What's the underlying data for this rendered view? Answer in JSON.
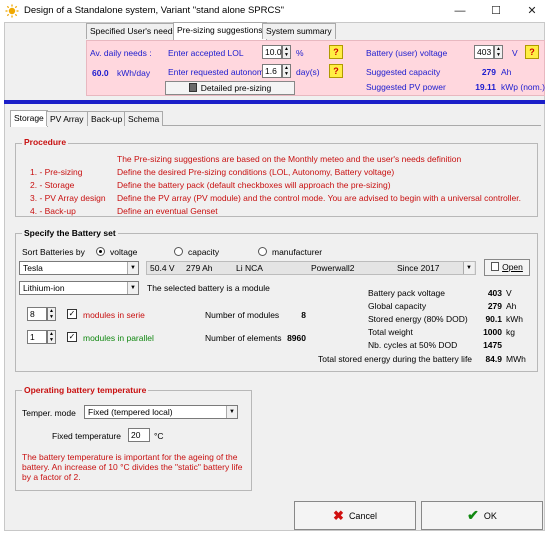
{
  "window": {
    "title": "Design of a Standalone system, Variant  \"stand alone SPRCS\"",
    "minimize": "—",
    "maximize": "☐",
    "close": "✕"
  },
  "top_tabs": [
    "Specified User's needs",
    "Pre-sizing suggestions",
    "System summary"
  ],
  "presizing": {
    "daily_needs_label": "Av. daily needs :",
    "daily_needs_value": "60.0",
    "daily_needs_unit": "kWh/day",
    "lol_label": "Enter accepted LOL",
    "lol_value": "10.0",
    "lol_unit": "%",
    "autonomy_label": "Enter requested autonomy",
    "autonomy_value": "1.6",
    "autonomy_unit": "day(s)",
    "detailed_button": "Detailed pre-sizing",
    "help": "?",
    "battery_voltage_label": "Battery (user) voltage",
    "battery_voltage_value": "403",
    "battery_voltage_unit": "V",
    "capacity_label": "Suggested capacity",
    "capacity_value": "279",
    "capacity_unit": "Ah",
    "pv_power_label": "Suggested PV power",
    "pv_power_value": "19.11",
    "pv_power_unit": "kWp (nom.)"
  },
  "sub_tabs": [
    "Storage",
    "PV Array",
    "Back-up",
    "Schema"
  ],
  "procedure": {
    "title": "Procedure",
    "intro": "The Pre-sizing  suggestions are based on the Monthly meteo and the user's needs definition",
    "steps": [
      {
        "label": "1. - Pre-sizing",
        "text": "Define the desired Pre-sizing  conditions  (LOL, Autonomy, Battery voltage)"
      },
      {
        "label": "2. - Storage",
        "text": "Define the battery pack  (default checkboxes will approach the pre-sizing)"
      },
      {
        "label": "3. - PV Array design",
        "text": "Define the PV array  (PV module) and the control mode. You are advised to begin with a universal controller."
      },
      {
        "label": "4. - Back-up",
        "text": "Define an eventual Genset"
      }
    ]
  },
  "battery_set": {
    "title": "Specify the Battery set",
    "sort_label": "Sort Batteries by",
    "sort_options": [
      "voltage",
      "capacity",
      "manufacturer"
    ],
    "manufacturer": "Tesla",
    "model_specs": {
      "voltage": "50.4 V",
      "capacity": "279 Ah",
      "tech": "Li NCA",
      "model": "Powerwall2",
      "since": "Since 2017"
    },
    "open_button": "Open",
    "technology": "Lithium-ion",
    "module_note": "The selected battery is a module",
    "series_value": "8",
    "series_label": "modules in serie",
    "parallel_value": "1",
    "parallel_label": "modules in parallel",
    "nb_modules_label": "Number of modules",
    "nb_modules_value": "8",
    "nb_elements_label": "Number of elements",
    "nb_elements_value": "8960",
    "summary": [
      {
        "label": "Battery pack voltage",
        "value": "403",
        "unit": "V"
      },
      {
        "label": "Global capacity",
        "value": "279",
        "unit": "Ah"
      },
      {
        "label": "Stored energy (80% DOD)",
        "value": "90.1",
        "unit": "kWh"
      },
      {
        "label": "Total weight",
        "value": "1000",
        "unit": "kg"
      },
      {
        "label": "Nb. cycles at 50% DOD",
        "value": "1475",
        "unit": ""
      },
      {
        "label": "Total stored energy during the battery life",
        "value": "84.9",
        "unit": "MWh"
      }
    ]
  },
  "temperature": {
    "title": "Operating battery temperature",
    "mode_label": "Temper. mode",
    "mode_value": "Fixed  (tempered local)",
    "fixed_label": "Fixed temperature",
    "fixed_value": "20",
    "fixed_unit": "°C",
    "note": "The battery temperature is important for the ageing of the battery. An increase of 10 °C divides the \"static\" battery life by a factor of 2."
  },
  "footer": {
    "cancel": "Cancel",
    "ok": "OK"
  },
  "colors": {
    "accent_blue": "#1b1fc8",
    "pink_panel": "#ffd7de",
    "red_text": "#c81010",
    "green_text": "#118811"
  }
}
